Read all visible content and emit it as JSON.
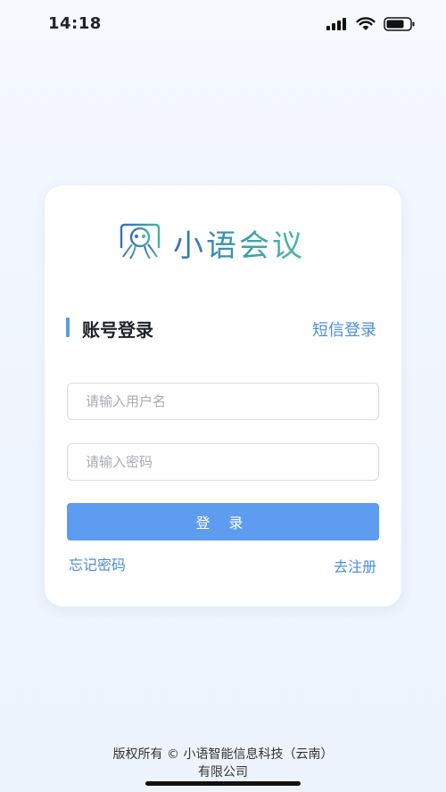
{
  "status_bar": {
    "time": "14:18",
    "icons": [
      "cellular-signal-icon",
      "wifi-icon",
      "battery-icon"
    ]
  },
  "logo": {
    "icon": "octopus-logo-icon",
    "text": "小语会议"
  },
  "login": {
    "section_title": "账号登录",
    "sms_login_label": "短信登录",
    "username_placeholder": "请输入用户名",
    "username_value": "",
    "password_placeholder": "请输入密码",
    "password_value": "",
    "login_button_label": "登 录",
    "forgot_password_label": "忘记密码",
    "register_label": "去注册"
  },
  "footer": {
    "copyright": "版权所有 © 小语智能信息科技（云南）有限公司"
  },
  "colors": {
    "accent": "#5e9cf0",
    "link": "#4a8de0",
    "background": "#eef4fd"
  }
}
